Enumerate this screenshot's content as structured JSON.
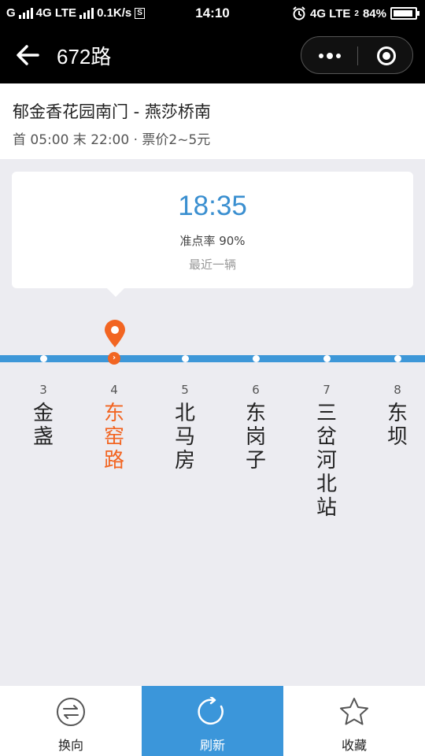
{
  "status_bar": {
    "carrier_left": "G",
    "network_type": "4G LTE",
    "speed": "0.1K/s",
    "time": "14:10",
    "network_right": "4G LTE",
    "sim_index": "2",
    "battery": "84%"
  },
  "nav": {
    "title": "672路"
  },
  "route": {
    "name": "郁金香花园南门 - 燕莎桥南",
    "meta": "首 05:00 末 22:00 · 票价2~5元"
  },
  "arrival": {
    "time": "18:35",
    "on_time_rate": "准点率 90%",
    "note": "最近一辆"
  },
  "stops": [
    {
      "num": "3",
      "name": "金盏"
    },
    {
      "num": "4",
      "name": "东窑路"
    },
    {
      "num": "5",
      "name": "北马房"
    },
    {
      "num": "6",
      "name": "东岗子"
    },
    {
      "num": "7",
      "name": "三岔河北站"
    },
    {
      "num": "8",
      "name": "东坝"
    }
  ],
  "current_stop_index": 1,
  "toolbar": {
    "switch_label": "换向",
    "refresh_label": "刷新",
    "favorite_label": "收藏"
  },
  "colors": {
    "accent_blue": "#3b96da",
    "current_orange": "#f26522"
  }
}
